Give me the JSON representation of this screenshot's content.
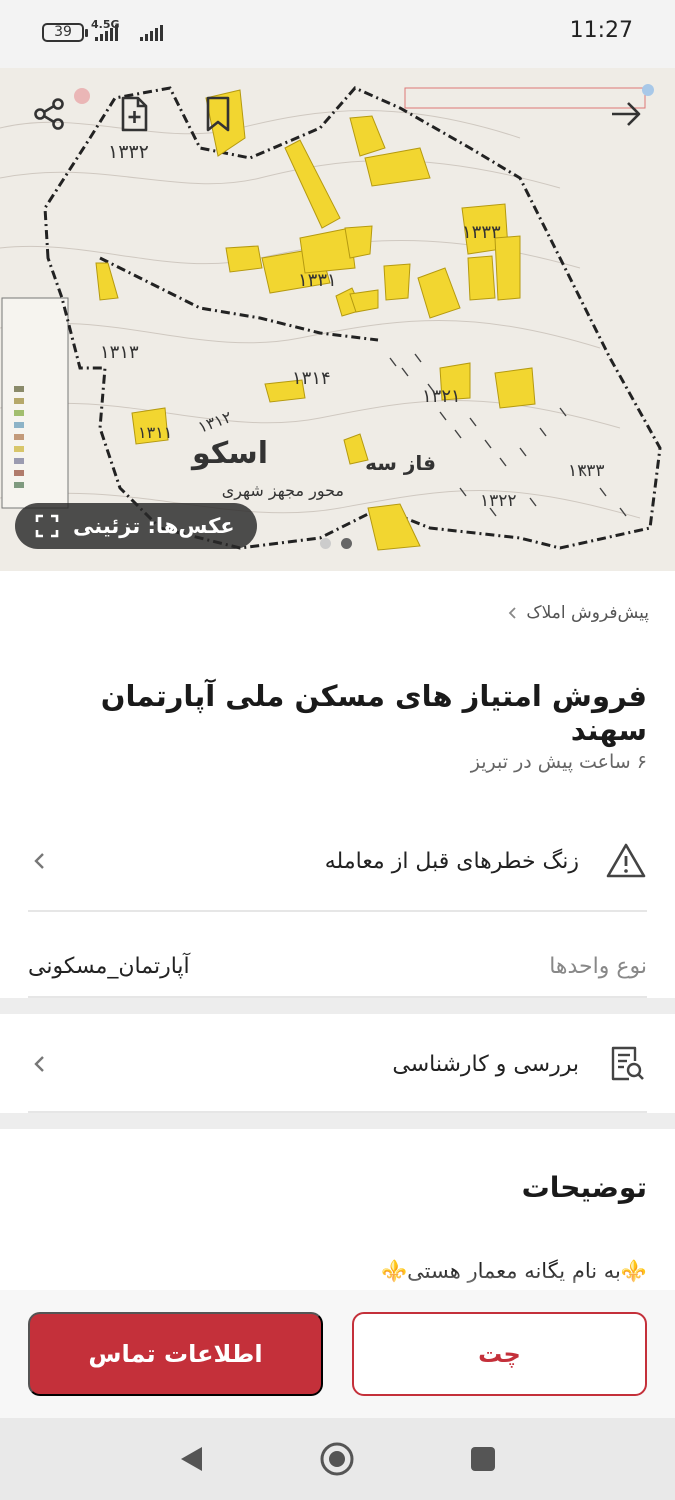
{
  "status_bar": {
    "time": "11:27",
    "battery": "39",
    "network": "4.5G"
  },
  "hero": {
    "photo_badge_label": "عکس‌ها: تزئینی",
    "map_labels": {
      "region_1332": "۱۳۳۲",
      "region_1333_top": "۱۳۳۳",
      "region_1331": "۱۳۳۱",
      "region_1313": "۱۳۱۳",
      "region_1314": "۱۳۱۴",
      "region_1321": "۱۳۲۱",
      "region_1311": "۱۳۱۱",
      "region_1312": "۱۳۱۲",
      "region_1333_right": "۱۳۳۳",
      "region_1322": "۱۳۲۲",
      "osku": "اسکو",
      "phase_3": "فاز سه",
      "urban_axis": "محور مجهز شهری"
    }
  },
  "breadcrumb": "پیش‌فروش املاک",
  "listing": {
    "title": "فروش امتیاز های مسکن ملی آپارتمان سهند",
    "subtitle": "۶ ساعت پیش در تبریز"
  },
  "rows": {
    "warning_label": "زنگ خطرهای قبل از معامله",
    "unit_type_key": "نوع واحدها",
    "unit_type_value": "آپارتمان_مسکونی",
    "review_label": "بررسی و کارشناسی"
  },
  "description": {
    "title": "توضیحات",
    "text": "⚜️به نام یگانه معمار هستی⚜️"
  },
  "actions": {
    "contact_label": "اطلاعات تماس",
    "chat_label": "چت"
  },
  "colors": {
    "brand_red": "#c4303a",
    "map_yellow": "#f2d630"
  },
  "icons": {
    "share": "share-icon",
    "add_note": "add-note-icon",
    "bookmark": "bookmark-icon",
    "back": "arrow-right-icon",
    "expand": "expand-icon",
    "warning": "warning-icon",
    "review": "document-search-icon",
    "chevron": "chevron-left-icon"
  }
}
